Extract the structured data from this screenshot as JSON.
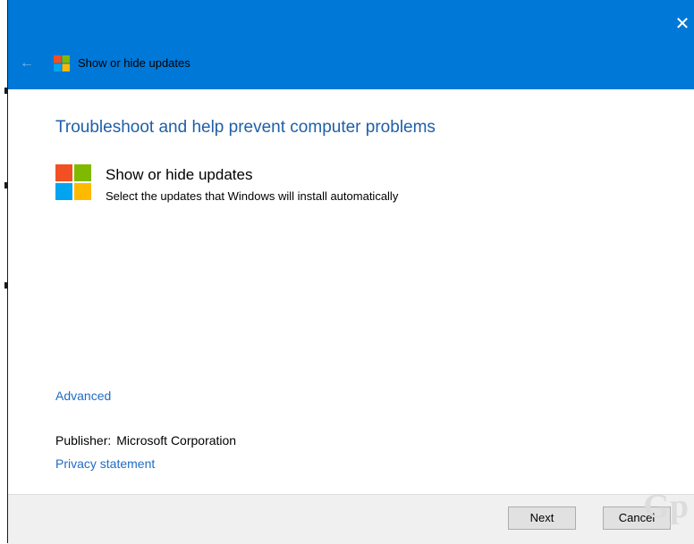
{
  "window": {
    "title": "Show or hide updates",
    "close_glyph": "✕",
    "back_glyph": "←"
  },
  "main": {
    "heading": "Troubleshoot and help prevent computer problems",
    "app_name": "Show or hide updates",
    "app_description": "Select the updates that Windows will install automatically",
    "advanced_link": "Advanced",
    "publisher_label": "Publisher:",
    "publisher_value": "Microsoft Corporation",
    "privacy_link": "Privacy statement"
  },
  "footer": {
    "next_label": "Next",
    "cancel_label": "Cancel"
  },
  "watermark": "Gp",
  "icons": [
    "close-icon",
    "back-arrow-icon",
    "windows-logo-icon"
  ],
  "colors": {
    "titlebar": "#0078d7",
    "heading": "#1f5fa8",
    "link": "#1f6cc4",
    "logo_red": "#f25022",
    "logo_green": "#7fba00",
    "logo_blue": "#00a4ef",
    "logo_yellow": "#ffb900"
  }
}
